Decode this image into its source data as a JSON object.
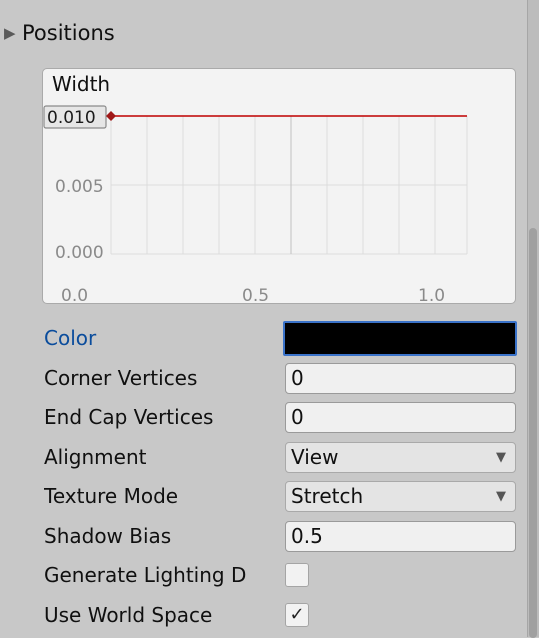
{
  "positions": {
    "label": "Positions"
  },
  "curve": {
    "title": "Width",
    "y_ticks": [
      "0.010",
      "0.005",
      "0.000"
    ],
    "x_ticks": [
      "0.0",
      "0.5",
      "1.0"
    ],
    "line_color": "#c00000",
    "key_color": "#a01818",
    "value": 0.01
  },
  "fields": {
    "color": {
      "label": "Color",
      "value": "#000000"
    },
    "corner_vertices": {
      "label": "Corner Vertices",
      "value": "0"
    },
    "end_cap_vertices": {
      "label": "End Cap Vertices",
      "value": "0"
    },
    "alignment": {
      "label": "Alignment",
      "value": "View"
    },
    "texture_mode": {
      "label": "Texture Mode",
      "value": "Stretch"
    },
    "shadow_bias": {
      "label": "Shadow Bias",
      "value": "0.5"
    },
    "generate_lighting": {
      "label": "Generate Lighting D",
      "checked": false
    },
    "use_world_space": {
      "label": "Use World Space",
      "checked": true
    }
  },
  "icons": {
    "foldout": "triangle-right-icon",
    "dropdown": "triangle-down-icon",
    "check": "checkmark-icon"
  }
}
